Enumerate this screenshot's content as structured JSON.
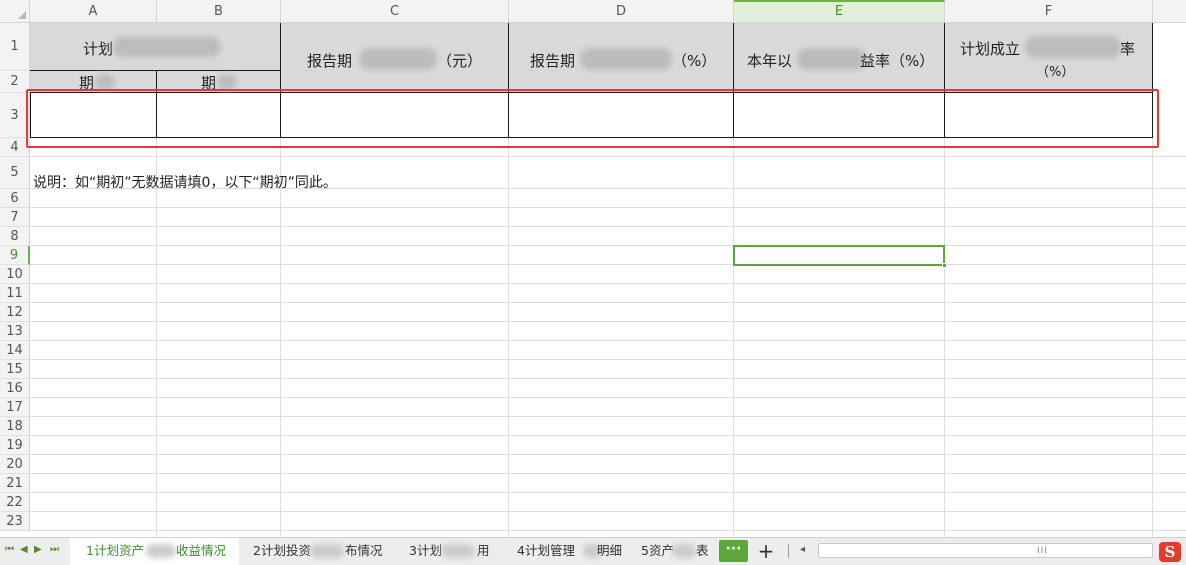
{
  "columns": [
    "A",
    "B",
    "C",
    "D",
    "E",
    "F"
  ],
  "active_column": "E",
  "rows": [
    "1",
    "2",
    "3",
    "4",
    "5",
    "6",
    "7",
    "8",
    "9",
    "10",
    "11",
    "12",
    "13",
    "14",
    "15",
    "16",
    "17",
    "18",
    "19",
    "20",
    "21",
    "22",
    "23"
  ],
  "active_row": "9",
  "header": {
    "ab_top": "计划",
    "a_sub": "期",
    "b_sub": "期",
    "c_left": "报告期",
    "c_right": "（元）",
    "d_left": "报告期",
    "d_right": "（%）",
    "e_left": "本年以",
    "e_right": "益率（%）",
    "f_left": "计划成立",
    "f_right": "率",
    "f_line2": "（%）"
  },
  "note": "说明：如“期初”无数据请填0，以下“期初”同此。",
  "sheet_tabs": [
    {
      "prefix": "1计划资产",
      "suffix": "收益情况",
      "active": true
    },
    {
      "prefix": "2计划投资",
      "suffix": "布情况",
      "active": false
    },
    {
      "prefix": "3计划",
      "suffix": "用",
      "active": false
    },
    {
      "prefix": "4计划管理",
      "suffix": "明细",
      "active": false
    },
    {
      "prefix": "5资产",
      "suffix": "表",
      "active": false
    }
  ],
  "tab_controls": {
    "more": "···",
    "add": "+",
    "first": "⏮",
    "prev": "◀",
    "next": "▶",
    "last": "⏭",
    "scroll_left": "◂",
    "scroll_grip": "III"
  },
  "icons": {
    "app_logo": "S"
  },
  "colors": {
    "accent_green": "#5da83a",
    "annotation_red": "#e53935",
    "header_fill": "#d9d9d9"
  }
}
